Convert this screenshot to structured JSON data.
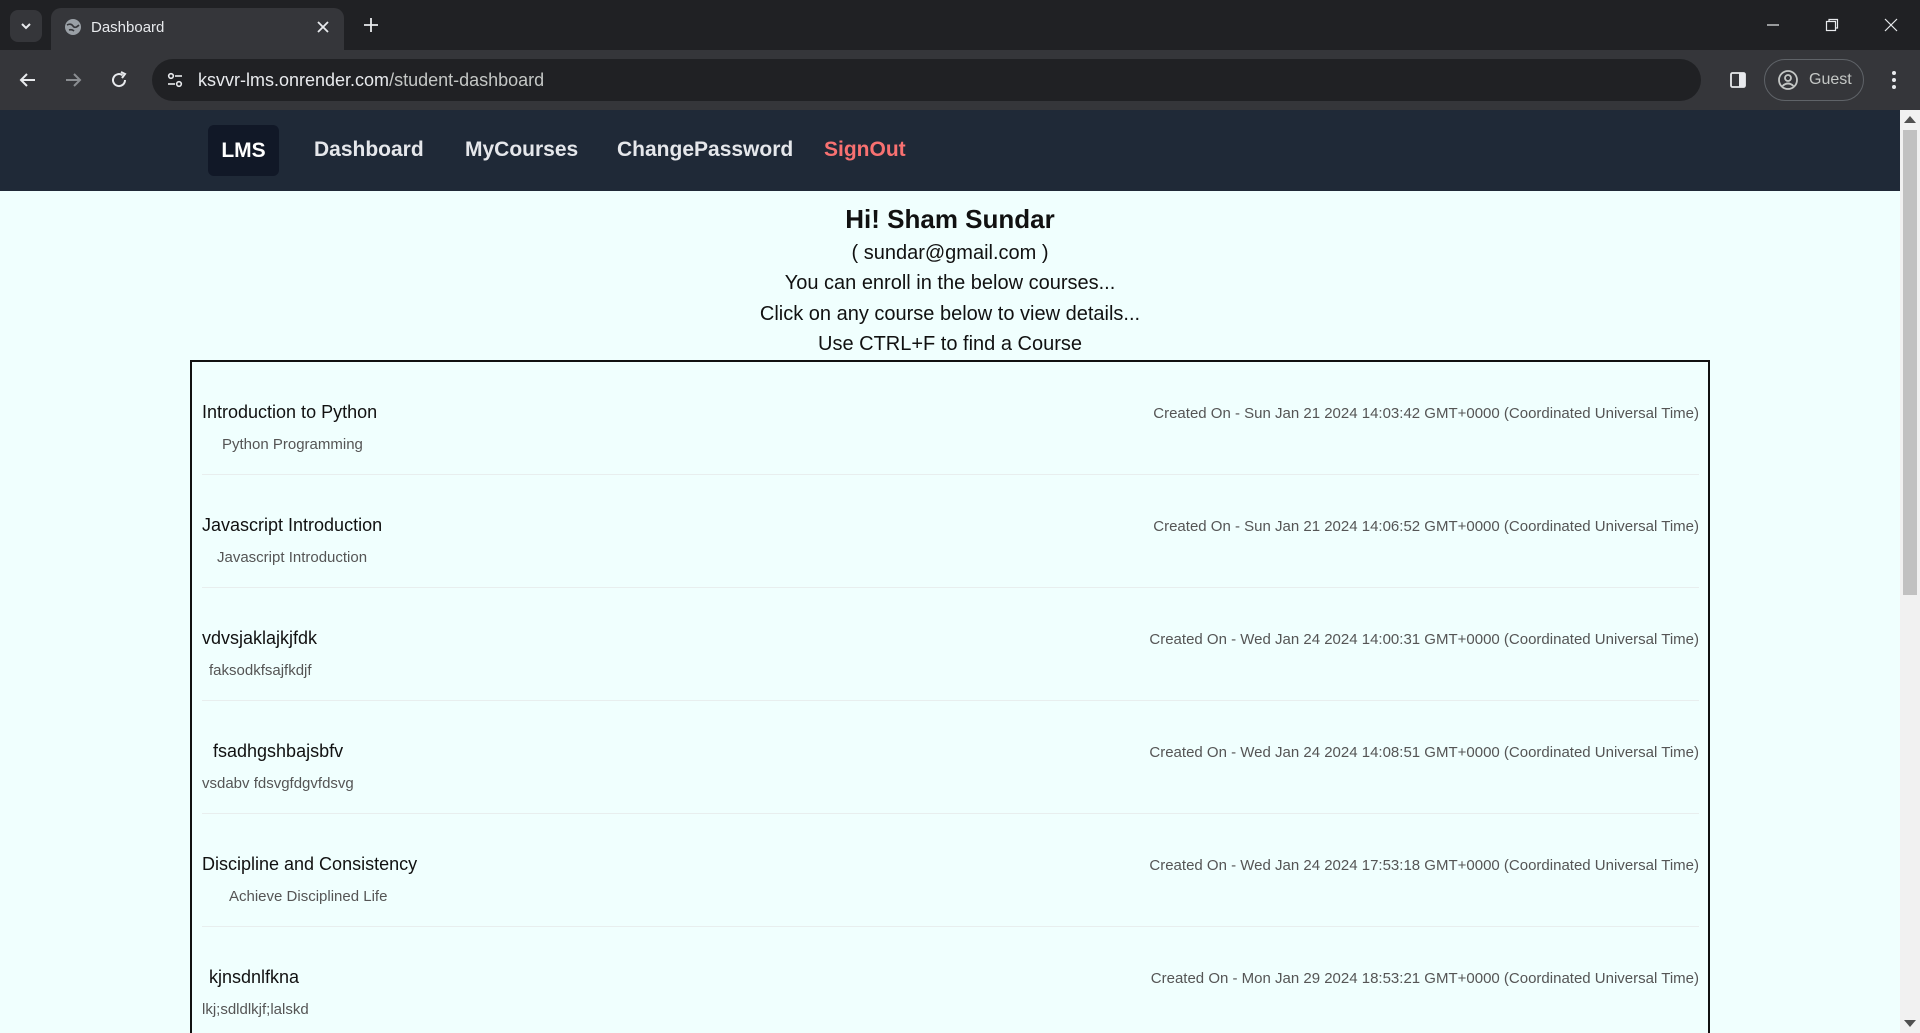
{
  "browser": {
    "tab_title": "Dashboard",
    "url_host": "ksvvr-lms.onrender.com",
    "url_path": "/student-dashboard",
    "profile_label": "Guest"
  },
  "nav": {
    "brand": "LMS",
    "links": [
      "Dashboard",
      "MyCourses",
      "ChangePassword"
    ],
    "signout": "SignOut"
  },
  "greeting": {
    "title": "Hi! Sham Sundar",
    "email": "( sundar@gmail.com )",
    "line1": "You can enroll in the below courses...",
    "line2": "Click on any course below to view details...",
    "line3": "Use CTRL+F to find a Course"
  },
  "courses": [
    {
      "title": "Introduction to Python",
      "description": "Python Programming",
      "created": "Created On - Sun Jan 21 2024 14:03:42 GMT+0000 (Coordinated Universal Time)"
    },
    {
      "title": "Javascript Introduction",
      "description": "Javascript Introduction",
      "created": "Created On - Sun Jan 21 2024 14:06:52 GMT+0000 (Coordinated Universal Time)"
    },
    {
      "title": "vdvsjaklajkjfdk",
      "description": "faksodkfsajfkdjf",
      "created": "Created On - Wed Jan 24 2024 14:00:31 GMT+0000 (Coordinated Universal Time)"
    },
    {
      "title": "fsadhgshbajsbfv",
      "description": "vsdabv fdsvgfdgvfdsvg",
      "created": "Created On - Wed Jan 24 2024 14:08:51 GMT+0000 (Coordinated Universal Time)"
    },
    {
      "title": "Discipline and Consistency",
      "description": "Achieve Disciplined Life",
      "created": "Created On - Wed Jan 24 2024 17:53:18 GMT+0000 (Coordinated Universal Time)"
    },
    {
      "title": "kjnsdnlfkna",
      "description": "lkj;sdldlkjf;lalskd",
      "created": "Created On - Mon Jan 29 2024 18:53:21 GMT+0000 (Coordinated Universal Time)"
    }
  ]
}
